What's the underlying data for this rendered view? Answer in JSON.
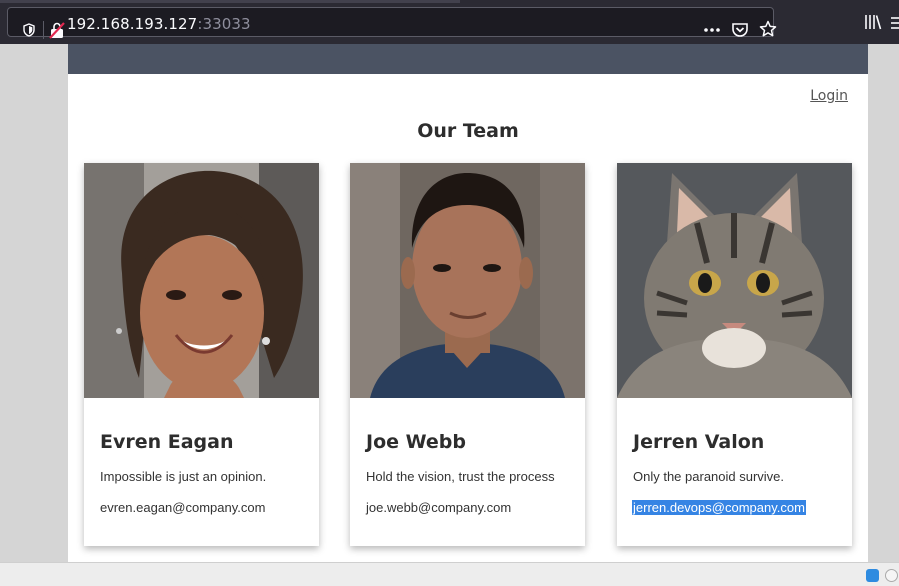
{
  "browser": {
    "url_host": "192.168.193.127",
    "url_port": ":33033"
  },
  "page": {
    "login_label": "Login",
    "title": "Our Team"
  },
  "team": [
    {
      "name": "Evren Eagan",
      "motto": "Impossible is just an opinion.",
      "email": "evren.eagan@company.com"
    },
    {
      "name": "Joe Webb",
      "motto": "Hold the vision, trust the process",
      "email": "joe.webb@company.com"
    },
    {
      "name": "Jerren Valon",
      "motto": "Only the paranoid survive.",
      "email": "jerren.devops@company.com"
    }
  ],
  "colors": {
    "header_band": "#4b5363",
    "selection": "#3584e4"
  }
}
